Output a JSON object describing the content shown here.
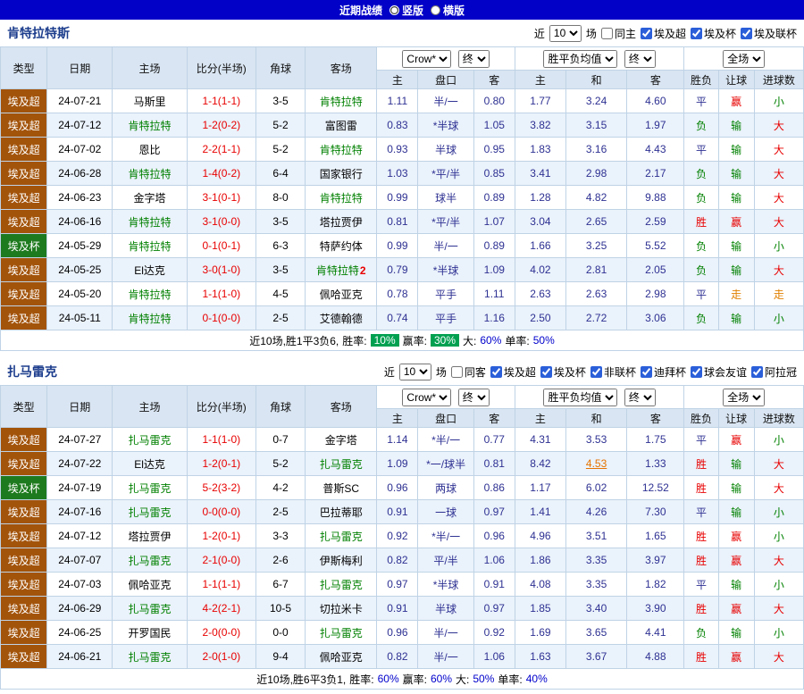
{
  "colors": {
    "bar_blue": "#0101C8",
    "header_bg": "#D9E5F2",
    "row_alt_bg": "#EAF2FB",
    "grid_border": "#BFD3E6",
    "league_super_bg": "#A3540B",
    "league_cup_bg": "#1E7A1E",
    "win_red": "#E80000",
    "lose_green": "#008000",
    "draw_blue": "#2E3192",
    "walk_orange": "#E08000",
    "team_highlight_green": "#008000",
    "odds_blue": "#2E3192",
    "changed_orange": "#E67300",
    "badge_green": "#00A050",
    "team_name_blue": "#1B3C8C",
    "pct_blue": "#0000CC"
  },
  "topbar": {
    "title": "近期战绩",
    "options": [
      {
        "label": "竖版",
        "selected": true
      },
      {
        "label": "横版",
        "selected": false
      }
    ]
  },
  "table_headers": {
    "type": "类型",
    "date": "日期",
    "home": "主场",
    "score": "比分(半场)",
    "corner": "角球",
    "away": "客场",
    "odds_group": {
      "select1": "Crow*",
      "select2": "终",
      "cols": [
        "主",
        "盘口",
        "客"
      ]
    },
    "avg_group": {
      "select1": "胜平负均值",
      "select2": "终",
      "cols": [
        "主",
        "和",
        "客"
      ]
    },
    "result_group": {
      "select": "全场",
      "cols": [
        "胜负",
        "让球",
        "进球数"
      ]
    }
  },
  "team1": {
    "name": "肯特拉特斯",
    "filter": {
      "near": "近",
      "count": "10",
      "unit": "场",
      "same": "同主",
      "same_checked": false,
      "leagues": [
        "埃及超",
        "埃及杯",
        "埃及联杯"
      ]
    },
    "rows": [
      {
        "league": "埃及超",
        "cup": false,
        "date": "24-07-21",
        "home": "马斯里",
        "home_hl": false,
        "score": "1-1(1-1)",
        "corner": "3-5",
        "away": "肯特拉特",
        "away_hl": true,
        "odds": [
          "1.11",
          "半/一",
          "0.80"
        ],
        "avg": [
          "1.77",
          "3.24",
          "4.60"
        ],
        "result": "平",
        "give": "赢",
        "goals": "小"
      },
      {
        "league": "埃及超",
        "cup": false,
        "date": "24-07-12",
        "home": "肯特拉特",
        "home_hl": true,
        "score": "1-2(0-2)",
        "corner": "5-2",
        "away": "富图雷",
        "away_hl": false,
        "odds": [
          "0.83",
          "*半球",
          "1.05"
        ],
        "avg": [
          "3.82",
          "3.15",
          "1.97"
        ],
        "result": "负",
        "give": "输",
        "goals": "大"
      },
      {
        "league": "埃及超",
        "cup": false,
        "date": "24-07-02",
        "home": "恩比",
        "home_hl": false,
        "score": "2-2(1-1)",
        "corner": "5-2",
        "away": "肯特拉特",
        "away_hl": true,
        "odds": [
          "0.93",
          "半球",
          "0.95"
        ],
        "avg": [
          "1.83",
          "3.16",
          "4.43"
        ],
        "result": "平",
        "give": "输",
        "goals": "大"
      },
      {
        "league": "埃及超",
        "cup": false,
        "date": "24-06-28",
        "home": "肯特拉特",
        "home_hl": true,
        "score": "1-4(0-2)",
        "corner": "6-4",
        "away": "国家银行",
        "away_hl": false,
        "odds": [
          "1.03",
          "*平/半",
          "0.85"
        ],
        "avg": [
          "3.41",
          "2.98",
          "2.17"
        ],
        "result": "负",
        "give": "输",
        "goals": "大"
      },
      {
        "league": "埃及超",
        "cup": false,
        "date": "24-06-23",
        "home": "金字塔",
        "home_hl": false,
        "score": "3-1(0-1)",
        "corner": "8-0",
        "away": "肯特拉特",
        "away_hl": true,
        "odds": [
          "0.99",
          "球半",
          "0.89"
        ],
        "avg": [
          "1.28",
          "4.82",
          "9.88"
        ],
        "result": "负",
        "give": "输",
        "goals": "大"
      },
      {
        "league": "埃及超",
        "cup": false,
        "date": "24-06-16",
        "home": "肯特拉特",
        "home_hl": true,
        "score": "3-1(0-0)",
        "corner": "3-5",
        "away": "塔拉贾伊",
        "away_hl": false,
        "odds": [
          "0.81",
          "*平/半",
          "1.07"
        ],
        "avg": [
          "3.04",
          "2.65",
          "2.59"
        ],
        "result": "胜",
        "give": "赢",
        "goals": "大"
      },
      {
        "league": "埃及杯",
        "cup": true,
        "date": "24-05-29",
        "home": "肯特拉特",
        "home_hl": true,
        "score": "0-1(0-1)",
        "corner": "6-3",
        "away": "特萨约体",
        "away_hl": false,
        "odds": [
          "0.99",
          "半/一",
          "0.89"
        ],
        "avg": [
          "1.66",
          "3.25",
          "5.52"
        ],
        "result": "负",
        "give": "输",
        "goals": "小"
      },
      {
        "league": "埃及超",
        "cup": false,
        "date": "24-05-25",
        "home": "El达克",
        "home_hl": false,
        "score": "3-0(1-0)",
        "corner": "3-5",
        "away": "肯特拉特",
        "away_hl": true,
        "away_mark": "2",
        "odds": [
          "0.79",
          "*半球",
          "1.09"
        ],
        "avg": [
          "4.02",
          "2.81",
          "2.05"
        ],
        "result": "负",
        "give": "输",
        "goals": "大"
      },
      {
        "league": "埃及超",
        "cup": false,
        "date": "24-05-20",
        "home": "肯特拉特",
        "home_hl": true,
        "score": "1-1(1-0)",
        "corner": "4-5",
        "away": "佩哈亚克",
        "away_hl": false,
        "odds": [
          "0.78",
          "平手",
          "1.11"
        ],
        "avg": [
          "2.63",
          "2.63",
          "2.98"
        ],
        "result": "平",
        "give": "走",
        "goals": "走"
      },
      {
        "league": "埃及超",
        "cup": false,
        "date": "24-05-11",
        "home": "肯特拉特",
        "home_hl": true,
        "score": "0-1(0-0)",
        "corner": "2-5",
        "away": "艾德翰德",
        "away_hl": false,
        "odds": [
          "0.74",
          "平手",
          "1.16"
        ],
        "avg": [
          "2.50",
          "2.72",
          "3.06"
        ],
        "result": "负",
        "give": "输",
        "goals": "小"
      }
    ],
    "summary": {
      "text": "近10场,胜1平3负6,",
      "win_label": "胜率:",
      "win": "10%",
      "cover_label": "赢率:",
      "cover": "30%",
      "big_label": "大:",
      "big": "60%",
      "single_label": "单率:",
      "single": "50%"
    }
  },
  "team2": {
    "name": "扎马雷克",
    "filter": {
      "near": "近",
      "count": "10",
      "unit": "场",
      "same": "同客",
      "same_checked": false,
      "leagues": [
        "埃及超",
        "埃及杯",
        "非联杯",
        "迪拜杯",
        "球会友谊",
        "阿拉冠"
      ]
    },
    "rows": [
      {
        "league": "埃及超",
        "cup": false,
        "date": "24-07-27",
        "home": "扎马雷克",
        "home_hl": true,
        "score": "1-1(1-0)",
        "corner": "0-7",
        "away": "金字塔",
        "away_hl": false,
        "odds": [
          "1.14",
          "*半/一",
          "0.77"
        ],
        "avg": [
          "4.31",
          "3.53",
          "1.75"
        ],
        "result": "平",
        "give": "赢",
        "goals": "小"
      },
      {
        "league": "埃及超",
        "cup": false,
        "date": "24-07-22",
        "home": "El达克",
        "home_hl": false,
        "score": "1-2(0-1)",
        "corner": "5-2",
        "away": "扎马雷克",
        "away_hl": true,
        "odds": [
          "1.09",
          "*一/球半",
          "0.81"
        ],
        "avg": [
          "8.42",
          "4.53",
          "1.33"
        ],
        "avg_changed": true,
        "result": "胜",
        "give": "输",
        "goals": "大"
      },
      {
        "league": "埃及杯",
        "cup": true,
        "date": "24-07-19",
        "home": "扎马雷克",
        "home_hl": true,
        "score": "5-2(3-2)",
        "corner": "4-2",
        "away": "普斯SC",
        "away_hl": false,
        "odds": [
          "0.96",
          "两球",
          "0.86"
        ],
        "avg": [
          "1.17",
          "6.02",
          "12.52"
        ],
        "result": "胜",
        "give": "输",
        "goals": "大"
      },
      {
        "league": "埃及超",
        "cup": false,
        "date": "24-07-16",
        "home": "扎马雷克",
        "home_hl": true,
        "score": "0-0(0-0)",
        "corner": "2-5",
        "away": "巴拉蒂耶",
        "away_hl": false,
        "odds": [
          "0.91",
          "一球",
          "0.97"
        ],
        "avg": [
          "1.41",
          "4.26",
          "7.30"
        ],
        "result": "平",
        "give": "输",
        "goals": "小"
      },
      {
        "league": "埃及超",
        "cup": false,
        "date": "24-07-12",
        "home": "塔拉贾伊",
        "home_hl": false,
        "score": "1-2(0-1)",
        "corner": "3-3",
        "away": "扎马雷克",
        "away_hl": true,
        "odds": [
          "0.92",
          "*半/一",
          "0.96"
        ],
        "avg": [
          "4.96",
          "3.51",
          "1.65"
        ],
        "result": "胜",
        "give": "赢",
        "goals": "小"
      },
      {
        "league": "埃及超",
        "cup": false,
        "date": "24-07-07",
        "home": "扎马雷克",
        "home_hl": true,
        "score": "2-1(0-0)",
        "corner": "2-6",
        "away": "伊斯梅利",
        "away_hl": false,
        "odds": [
          "0.82",
          "平/半",
          "1.06"
        ],
        "avg": [
          "1.86",
          "3.35",
          "3.97"
        ],
        "result": "胜",
        "give": "赢",
        "goals": "大"
      },
      {
        "league": "埃及超",
        "cup": false,
        "date": "24-07-03",
        "home": "佩哈亚克",
        "home_hl": false,
        "score": "1-1(1-1)",
        "corner": "6-7",
        "away": "扎马雷克",
        "away_hl": true,
        "odds": [
          "0.97",
          "*半球",
          "0.91"
        ],
        "avg": [
          "4.08",
          "3.35",
          "1.82"
        ],
        "result": "平",
        "give": "输",
        "goals": "小"
      },
      {
        "league": "埃及超",
        "cup": false,
        "date": "24-06-29",
        "home": "扎马雷克",
        "home_hl": true,
        "score": "4-2(2-1)",
        "corner": "10-5",
        "away": "切拉米卡",
        "away_hl": false,
        "odds": [
          "0.91",
          "半球",
          "0.97"
        ],
        "avg": [
          "1.85",
          "3.40",
          "3.90"
        ],
        "result": "胜",
        "give": "赢",
        "goals": "大"
      },
      {
        "league": "埃及超",
        "cup": false,
        "date": "24-06-25",
        "home": "开罗国民",
        "home_hl": false,
        "score": "2-0(0-0)",
        "corner": "0-0",
        "away": "扎马雷克",
        "away_hl": true,
        "odds": [
          "0.96",
          "半/一",
          "0.92"
        ],
        "avg": [
          "1.69",
          "3.65",
          "4.41"
        ],
        "result": "负",
        "give": "输",
        "goals": "小"
      },
      {
        "league": "埃及超",
        "cup": false,
        "date": "24-06-21",
        "home": "扎马雷克",
        "home_hl": true,
        "score": "2-0(1-0)",
        "corner": "9-4",
        "away": "佩哈亚克",
        "away_hl": false,
        "odds": [
          "0.82",
          "半/一",
          "1.06"
        ],
        "avg": [
          "1.63",
          "3.67",
          "4.88"
        ],
        "result": "胜",
        "give": "赢",
        "goals": "大"
      }
    ],
    "summary": {
      "text": "近10场,胜6平3负1,",
      "win_label": "胜率:",
      "win": "60%",
      "cover_label": "赢率:",
      "cover": "60%",
      "big_label": "大:",
      "big": "50%",
      "single_label": "单率:",
      "single": "40%"
    }
  }
}
